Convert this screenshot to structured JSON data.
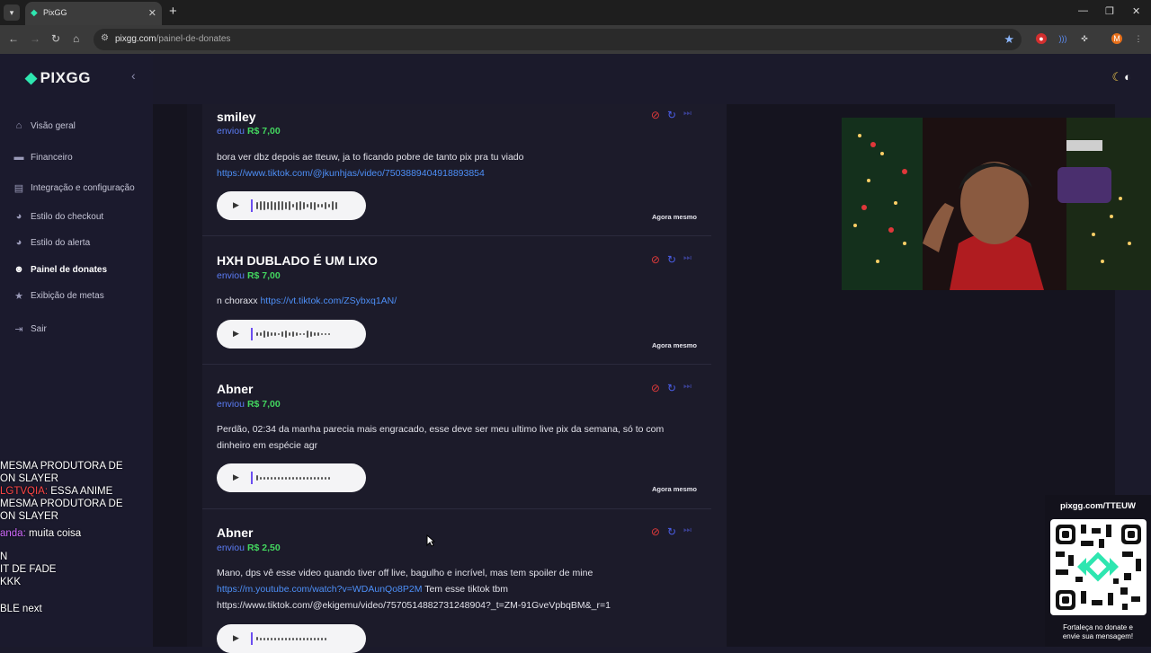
{
  "browser": {
    "tab_title": "PixGG",
    "url_host": "pixgg.com",
    "url_path": "/painel-de-donates",
    "profile_initial": "M"
  },
  "app": {
    "logo": "PIXGG",
    "menu": [
      {
        "label": "Visão geral",
        "icon": "home-icon"
      },
      {
        "label": "Financeiro",
        "icon": "wallet-icon"
      },
      {
        "label": "Integração e configuração",
        "icon": "settings-icon"
      },
      {
        "label": "Estilo do checkout",
        "icon": "palette-icon"
      },
      {
        "label": "Estilo do alerta",
        "icon": "palette-icon"
      },
      {
        "label": "Painel de donates",
        "icon": "users-icon",
        "active": true
      },
      {
        "label": "Exibição de metas",
        "icon": "star-icon"
      },
      {
        "label": "Sair",
        "icon": "logout-icon"
      }
    ]
  },
  "donations": [
    {
      "name": "smiley",
      "sent_label": "enviou",
      "amount": "R$ 7,00",
      "message": "bora ver dbz depois ae tteuw, ja to ficando pobre de tanto pix pra tu viado",
      "link": "https://www.tiktok.com/@jkunhjas/video/7503889404918893854",
      "time": "Agora mesmo"
    },
    {
      "name": "HXH DUBLADO É UM LIXO",
      "sent_label": "enviou",
      "amount": "R$ 7,00",
      "message": "n choraxx",
      "link": "https://vt.tiktok.com/ZSybxq1AN/",
      "time": "Agora mesmo"
    },
    {
      "name": "Abner",
      "sent_label": "enviou",
      "amount": "R$ 7,00",
      "message": "Perdão, 02:34 da manha parecia mais engracado, esse deve ser meu ultimo live pix da semana, só to com dinheiro em espécie agr",
      "time": "Agora mesmo"
    },
    {
      "name": "Abner",
      "sent_label": "enviou",
      "amount": "R$ 2,50",
      "message": "Mano, dps vê esse video quando tiver off live, bagulho e incrível, mas tem spoiler de mine",
      "link": "https://m.youtube.com/watch?v=WDAunQo8P2M",
      "link_suffix": "Tem esse tiktok tbm",
      "message_tail": "https://www.tiktok.com/@ekigemu/video/7570514882731248904?_t=ZM-91GveVpbqBM&_r=1"
    }
  ],
  "chat_lines": [
    {
      "user": "",
      "text": "MESMA PRODUTORA DE"
    },
    {
      "user": "",
      "text": "ON SLAYER"
    },
    {
      "user": "LGTVQIA:",
      "text": " ESSA ANIME"
    },
    {
      "user": "",
      "text": "MESMA PRODUTORA DE"
    },
    {
      "user": "",
      "text": "ON SLAYER"
    },
    {
      "user": "anda:",
      "text": " muita coisa"
    },
    {
      "user": "",
      "text": "N"
    },
    {
      "user": "",
      "text": "IT DE FADE"
    },
    {
      "user": "",
      "text": "KKK"
    },
    {
      "user": "",
      "text": "BLE next"
    }
  ],
  "qr": {
    "title": "pixgg.com/TTEUW",
    "caption_1": "Fortaleça no donate e",
    "caption_2": "envie sua mensagem!"
  }
}
